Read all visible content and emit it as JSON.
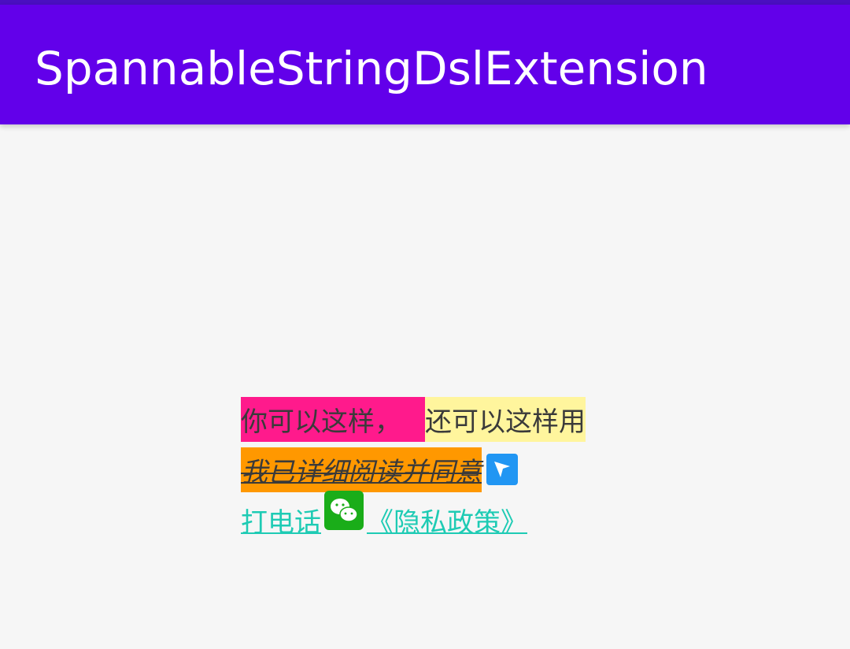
{
  "app_bar": {
    "title": "SpannableStringDslExtension"
  },
  "content": {
    "line1": {
      "pink_text": "你可以这样，",
      "yellow_text": "还可以这样用"
    },
    "line2": {
      "agree_text": "我已详细阅读并同意",
      "icon": "send-icon"
    },
    "line3": {
      "call_text": "打电话",
      "icon": "wechat-icon",
      "policy_text": "《隐私政策》"
    }
  },
  "colors": {
    "app_bar": "#6200ea",
    "pink_highlight": "#ff1a8c",
    "yellow_highlight": "#fff59d",
    "orange_highlight": "#ff9800",
    "link": "#1ecbb4",
    "wechat": "#1aad19",
    "send_icon": "#2196f3"
  }
}
